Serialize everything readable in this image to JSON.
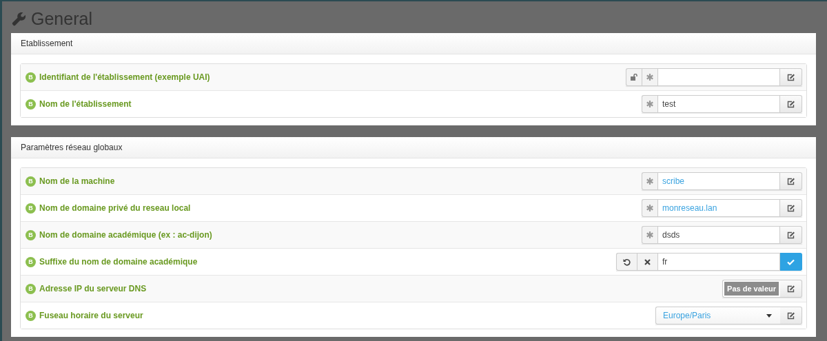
{
  "page": {
    "title": "General"
  },
  "sections": [
    {
      "title": "Etablissement",
      "fields": [
        {
          "badge": "B",
          "label": "Identifiant de l'établissement (exemple UAI)",
          "kind": "text",
          "has_lock": true,
          "required": true,
          "default_value": false
        },
        {
          "badge": "B",
          "label": "Nom de l'établissement",
          "kind": "text",
          "has_lock": false,
          "required": true,
          "value": "test",
          "default_value": false
        }
      ]
    },
    {
      "title": "Paramètres réseau globaux",
      "fields": [
        {
          "badge": "B",
          "label": "Nom de la machine",
          "kind": "text",
          "has_lock": false,
          "required": true,
          "value": "scribe",
          "default_value": true
        },
        {
          "badge": "B",
          "label": "Nom de domaine privé du reseau local",
          "kind": "text",
          "has_lock": false,
          "required": true,
          "value": "monreseau.lan",
          "default_value": true
        },
        {
          "badge": "B",
          "label": "Nom de domaine académique (ex : ac-dijon)",
          "kind": "text",
          "has_lock": false,
          "required": true,
          "value": "dsds",
          "default_value": false
        },
        {
          "badge": "B",
          "label": "Suffixe du nom de domaine académique",
          "kind": "editing",
          "value": "fr"
        },
        {
          "badge": "B",
          "label": "Adresse IP du serveur DNS",
          "kind": "empty",
          "empty_label": "Pas de valeur"
        },
        {
          "badge": "B",
          "label": "Fuseau horaire du serveur",
          "kind": "select",
          "value": "Europe/Paris",
          "default_value": true
        }
      ]
    }
  ]
}
